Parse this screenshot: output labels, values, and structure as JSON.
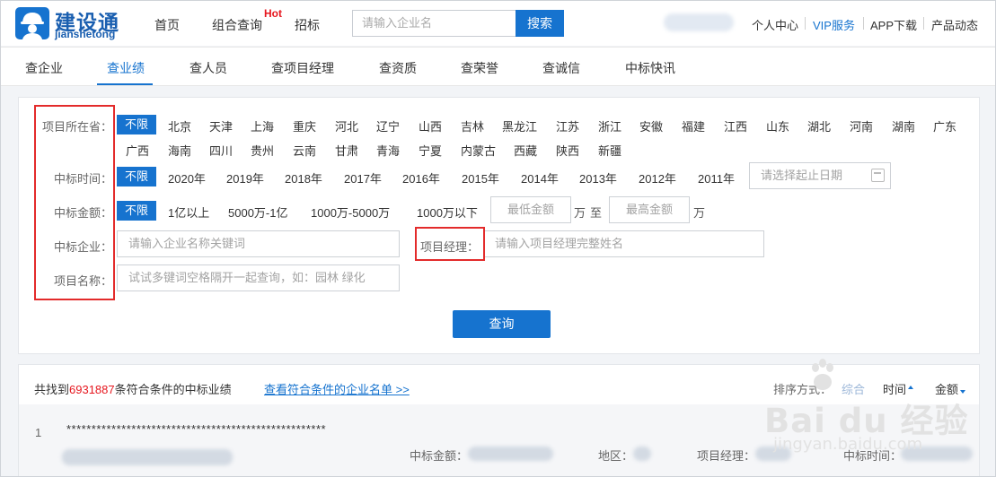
{
  "header": {
    "logo_cn": "建设通",
    "logo_en": "jianshetong",
    "nav": [
      {
        "label": "首页"
      },
      {
        "label": "组合查询"
      },
      {
        "label": "招标"
      }
    ],
    "hot_badge": "Hot",
    "search_placeholder": "请输入企业名",
    "search_button": "搜索",
    "links": [
      {
        "label": "个人中心"
      },
      {
        "label": "VIP服务"
      },
      {
        "label": "APP下载"
      },
      {
        "label": "产品动态"
      }
    ]
  },
  "tabs": [
    {
      "label": "查企业"
    },
    {
      "label": "查业绩"
    },
    {
      "label": "查人员"
    },
    {
      "label": "查项目经理"
    },
    {
      "label": "查资质"
    },
    {
      "label": "查荣誉"
    },
    {
      "label": "查诚信"
    },
    {
      "label": "中标快讯"
    }
  ],
  "filters": {
    "province": {
      "label": "项目所在省：",
      "options": [
        "不限",
        "北京",
        "天津",
        "上海",
        "重庆",
        "河北",
        "辽宁",
        "山西",
        "吉林",
        "黑龙江",
        "江苏",
        "浙江",
        "安徽",
        "福建",
        "江西",
        "山东",
        "湖北",
        "河南",
        "湖南",
        "广东",
        "广西",
        "海南",
        "四川",
        "贵州",
        "云南",
        "甘肃",
        "青海",
        "宁夏",
        "内蒙古",
        "西藏",
        "陕西",
        "新疆"
      ]
    },
    "time": {
      "label": "中标时间：",
      "options": [
        "不限",
        "2020年",
        "2019年",
        "2018年",
        "2017年",
        "2016年",
        "2015年",
        "2014年",
        "2013年",
        "2012年",
        "2011年"
      ],
      "date_placeholder": "请选择起止日期"
    },
    "amount": {
      "label": "中标金额：",
      "options": [
        "不限",
        "1亿以上",
        "5000万-1亿",
        "1000万-5000万",
        "1000万以下"
      ],
      "min_placeholder": "最低金额",
      "max_placeholder": "最高金额",
      "unit": "万",
      "to": "至"
    },
    "company": {
      "label": "中标企业：",
      "placeholder": "请输入企业名称关键词"
    },
    "manager": {
      "label": "项目经理：",
      "placeholder": "请输入项目经理完整姓名"
    },
    "project": {
      "label": "项目名称：",
      "placeholder": "试试多键词空格隔开一起查询，如：园林 绿化"
    },
    "query_button": "查询"
  },
  "results": {
    "prefix": "共找到",
    "count": "6931887",
    "suffix": "条符合条件的中标业绩",
    "company_list_link": "查看符合条件的企业名单 >>",
    "sort_label": "排序方式：",
    "sort_options": [
      "综合",
      "时间",
      "金额"
    ],
    "row": {
      "index": "1",
      "title": "****************************************************",
      "amount_label": "中标金额：",
      "region_label": "地区：",
      "manager_label": "项目经理：",
      "time_label": "中标时间："
    }
  },
  "watermark": {
    "text": "Bai du 经验",
    "url": "jingyan.baidu.com"
  },
  "colors": {
    "brand": "#1673cf",
    "hot": "#e6171f",
    "highlight_box": "#e32b2b"
  }
}
